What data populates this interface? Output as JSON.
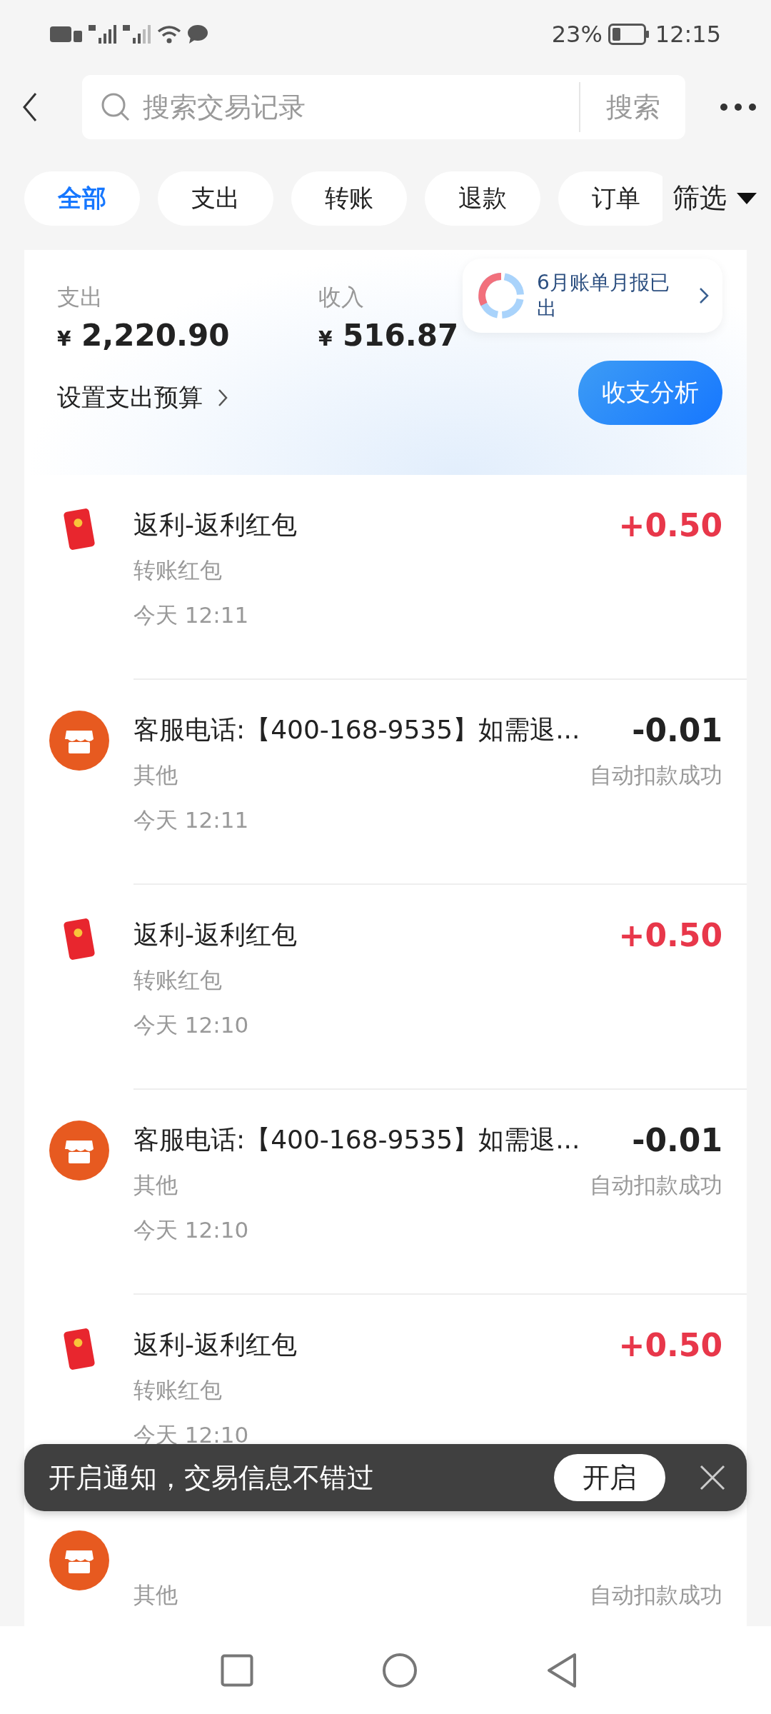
{
  "status_bar": {
    "battery": "23%",
    "time": "12:15"
  },
  "search": {
    "placeholder": "搜索交易记录",
    "button": "搜索"
  },
  "filters": [
    {
      "label": "全部",
      "selected": true
    },
    {
      "label": "支出",
      "selected": false
    },
    {
      "label": "转账",
      "selected": false
    },
    {
      "label": "退款",
      "selected": false
    },
    {
      "label": "订单",
      "selected": false
    }
  ],
  "filter_button": "筛选",
  "summary": {
    "expense_label": "支出",
    "expense": "2,220.90",
    "income_label": "收入",
    "income": "516.87",
    "currency": "¥",
    "budget_link": "设置支出预算",
    "report_tip": "6月账单月报已出",
    "analysis_button": "收支分析"
  },
  "transactions": [
    {
      "kind": "red_packet",
      "title": "返利-返利红包",
      "category": "转账红包",
      "time": "今天 12:11",
      "amount": "+0.50"
    },
    {
      "kind": "merchant",
      "title": "客服电话:【400-168-9535】如需退...",
      "category": "其他",
      "time": "今天 12:11",
      "amount": "-0.01",
      "status": "自动扣款成功"
    },
    {
      "kind": "red_packet",
      "title": "返利-返利红包",
      "category": "转账红包",
      "time": "今天 12:10",
      "amount": "+0.50"
    },
    {
      "kind": "merchant",
      "title": "客服电话:【400-168-9535】如需退...",
      "category": "其他",
      "time": "今天 12:10",
      "amount": "-0.01",
      "status": "自动扣款成功"
    },
    {
      "kind": "red_packet",
      "title": "返利-返利红包",
      "category": "转账红包",
      "time": "今天 12:10",
      "amount": "+0.50"
    },
    {
      "kind": "merchant",
      "category": "其他",
      "status": "自动扣款成功"
    }
  ],
  "toast": {
    "text": "开启通知，交易信息不错过",
    "button": "开启"
  }
}
